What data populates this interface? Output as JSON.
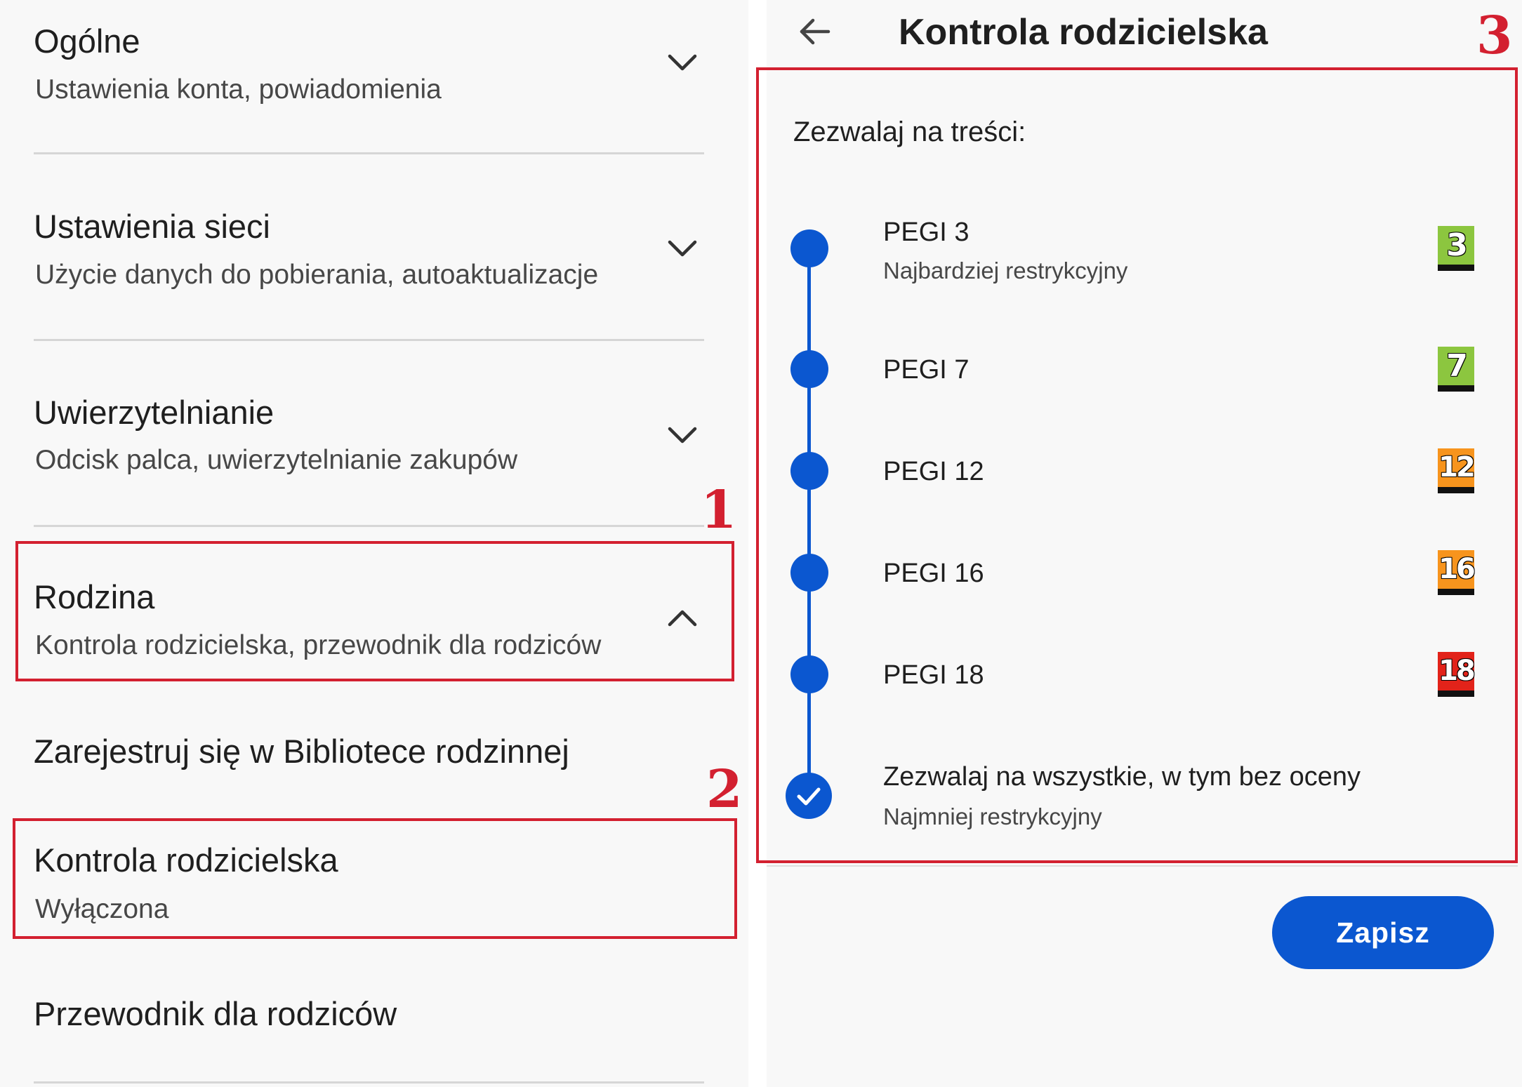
{
  "settings": {
    "items": [
      {
        "title": "Ogólne",
        "subtitle": "Ustawienia konta, powiadomienia"
      },
      {
        "title": "Ustawienia sieci",
        "subtitle": "Użycie danych do pobierania, autoaktualizacje"
      },
      {
        "title": "Uwierzytelnianie",
        "subtitle": "Odcisk palca, uwierzytelnianie zakupów"
      },
      {
        "title": "Rodzina",
        "subtitle": "Kontrola rodzicielska, przewodnik dla rodziców"
      }
    ],
    "family_sub": {
      "library_label": "Zarejestruj się w Bibliotece rodzinnej",
      "parental_title": "Kontrola rodzicielska",
      "parental_status": "Wyłączona",
      "guide_label": "Przewodnik dla rodziców"
    }
  },
  "annotations": {
    "one": "1",
    "two": "2",
    "three": "3"
  },
  "parental": {
    "title": "Kontrola rodzicielska",
    "allow_label": "Zezwalaj na treści:",
    "options": [
      {
        "title": "PEGI 3",
        "subtitle": "Najbardziej restrykcyjny",
        "badge": "3",
        "badge_color": "#8cc63f"
      },
      {
        "title": "PEGI 7",
        "badge": "7",
        "badge_color": "#8cc63f"
      },
      {
        "title": "PEGI 12",
        "badge": "12",
        "badge_color": "#f7941d"
      },
      {
        "title": "PEGI 16",
        "badge": "16",
        "badge_color": "#f7941d"
      },
      {
        "title": "PEGI 18",
        "badge": "18",
        "badge_color": "#e2231a"
      },
      {
        "title": "Zezwalaj na wszystkie, w tym bez oceny",
        "subtitle": "Najmniej restrykcyjny",
        "selected": true
      }
    ],
    "save_label": "Zapisz"
  },
  "colors": {
    "accent": "#0b57d0",
    "annotation": "#d32030"
  }
}
